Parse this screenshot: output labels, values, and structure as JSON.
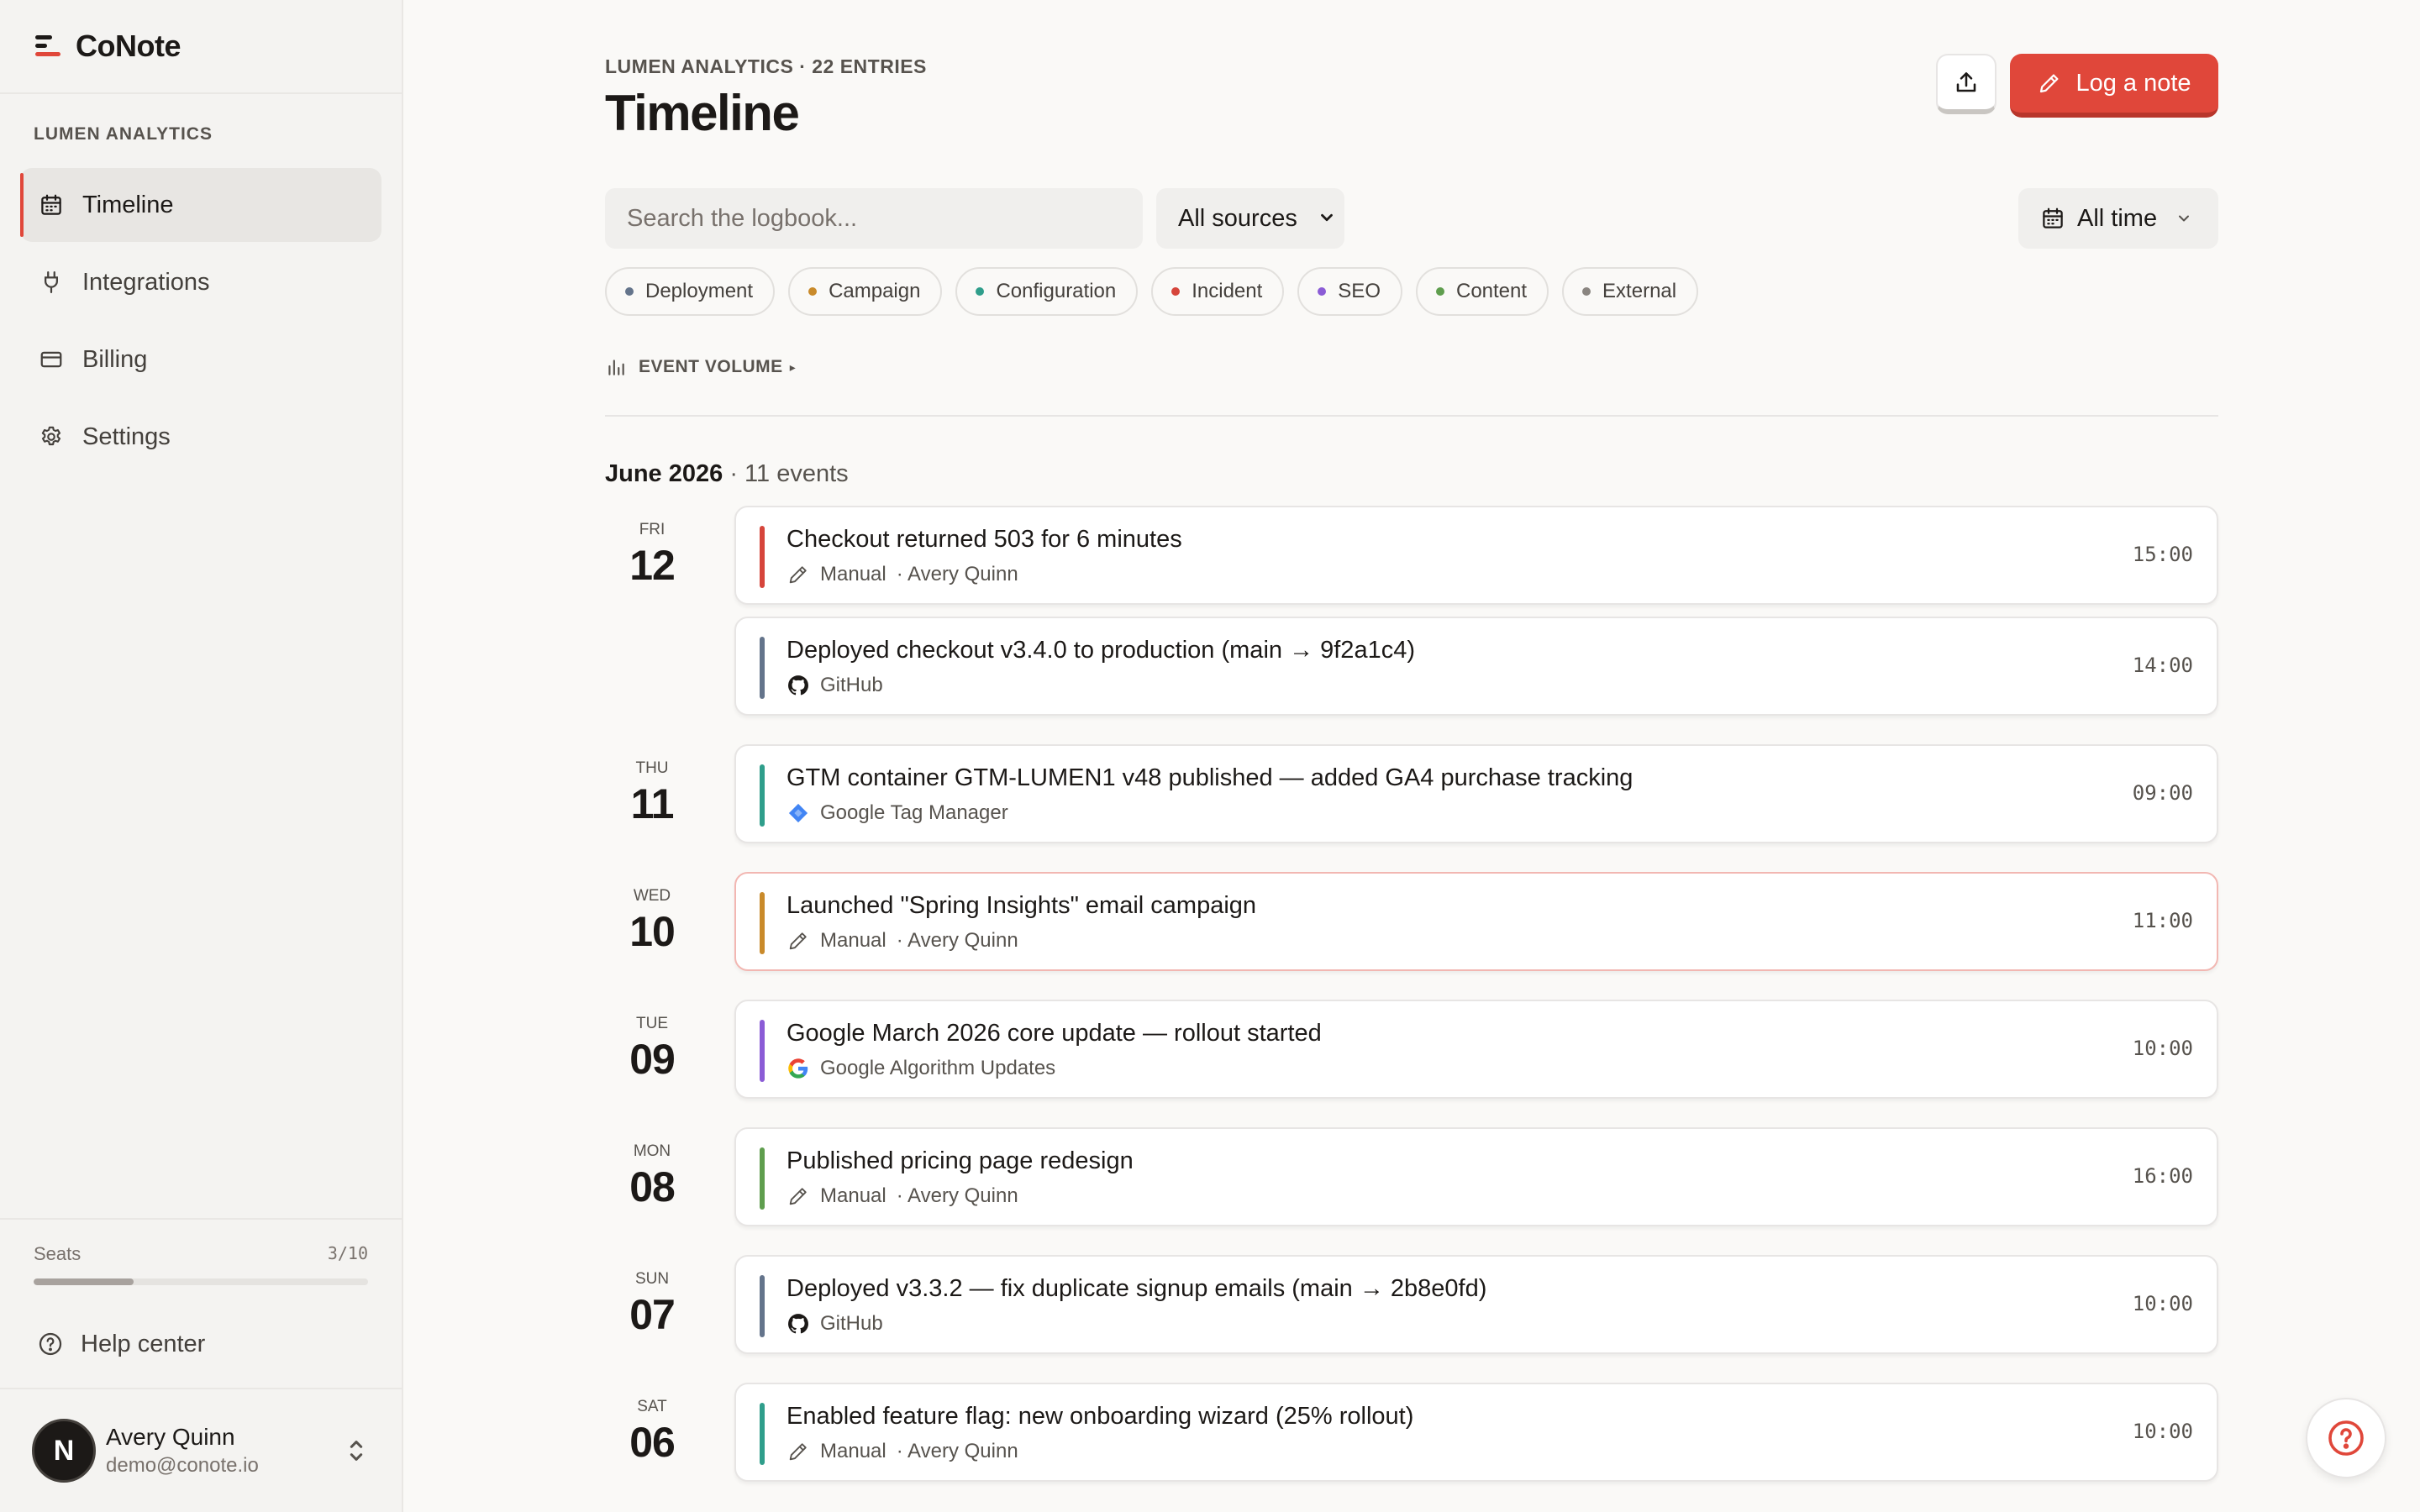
{
  "brand": {
    "name": "CoNote"
  },
  "sidebar": {
    "workspace": "LUMEN ANALYTICS",
    "items": [
      {
        "label": "Timeline",
        "icon": "calendar-icon",
        "active": true
      },
      {
        "label": "Integrations",
        "icon": "plug-icon",
        "active": false
      },
      {
        "label": "Billing",
        "icon": "credit-card-icon",
        "active": false
      },
      {
        "label": "Settings",
        "icon": "gear-icon",
        "active": false
      }
    ],
    "seats": {
      "label": "Seats",
      "value": "3/10",
      "used": 3,
      "total": 10
    },
    "help": "Help center",
    "user": {
      "initial": "N",
      "name": "Avery Quinn",
      "email": "demo@conote.io"
    }
  },
  "header": {
    "eyebrow": "LUMEN ANALYTICS · 22 ENTRIES",
    "title": "Timeline",
    "log_button": "Log a note"
  },
  "filters": {
    "search_placeholder": "Search the logbook...",
    "source": "All sources",
    "time": "All time",
    "chips": [
      {
        "label": "Deployment",
        "color": "#64748b"
      },
      {
        "label": "Campaign",
        "color": "#c98a2a"
      },
      {
        "label": "Configuration",
        "color": "#2f9e8b"
      },
      {
        "label": "Incident",
        "color": "#d6453b"
      },
      {
        "label": "SEO",
        "color": "#8b5cd6"
      },
      {
        "label": "Content",
        "color": "#5f9e4e"
      },
      {
        "label": "External",
        "color": "#8a8580"
      }
    ]
  },
  "volume_label": "EVENT VOLUME",
  "month": {
    "name": "June 2026",
    "count": "· 11 events"
  },
  "days": [
    {
      "dow": "FRI",
      "num": "12"
    },
    {
      "dow": "THU",
      "num": "11"
    },
    {
      "dow": "WED",
      "num": "10"
    },
    {
      "dow": "TUE",
      "num": "09"
    },
    {
      "dow": "MON",
      "num": "08"
    },
    {
      "dow": "SUN",
      "num": "07"
    },
    {
      "dow": "SAT",
      "num": "06"
    }
  ],
  "events": [
    {
      "title": "Checkout returned 503 for 6 minutes",
      "source": "Manual",
      "author": "· Avery Quinn",
      "time": "15:00",
      "color": "#d6453b",
      "icon": "pencil-icon"
    },
    {
      "title": "Deployed checkout v3.4.0 to production (main → 9f2a1c4)",
      "source": "GitHub",
      "author": "",
      "time": "14:00",
      "color": "#64748b",
      "icon": "github-icon"
    },
    {
      "title": "GTM container GTM-LUMEN1 v48 published — added GA4 purchase tracking",
      "source": "Google Tag Manager",
      "author": "",
      "time": "09:00",
      "color": "#2f9e8b",
      "icon": "gtm-icon"
    },
    {
      "title": "Launched \"Spring Insights\" email campaign",
      "source": "Manual",
      "author": "· Avery Quinn",
      "time": "11:00",
      "color": "#c98a2a",
      "icon": "pencil-icon"
    },
    {
      "title": "Google March 2026 core update — rollout started",
      "source": "Google Algorithm Updates",
      "author": "",
      "time": "10:00",
      "color": "#8b5cd6",
      "icon": "google-icon"
    },
    {
      "title": "Published pricing page redesign",
      "source": "Manual",
      "author": "· Avery Quinn",
      "time": "16:00",
      "color": "#5f9e4e",
      "icon": "pencil-icon"
    },
    {
      "title": "Deployed v3.3.2 — fix duplicate signup emails (main → 2b8e0fd)",
      "source": "GitHub",
      "author": "",
      "time": "10:00",
      "color": "#64748b",
      "icon": "github-icon"
    },
    {
      "title": "Enabled feature flag: new onboarding wizard (25% rollout)",
      "source": "Manual",
      "author": "· Avery Quinn",
      "time": "10:00",
      "color": "#2f9e8b",
      "icon": "pencil-icon"
    }
  ]
}
